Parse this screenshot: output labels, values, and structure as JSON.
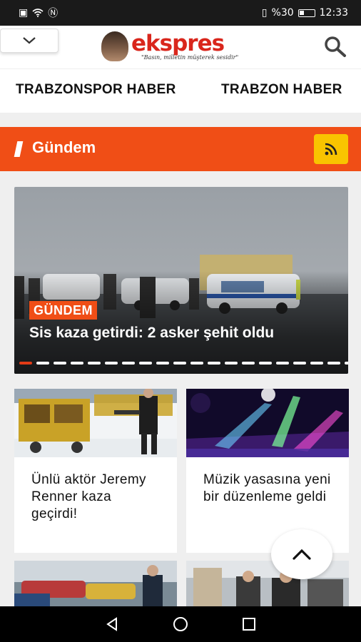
{
  "status_bar": {
    "battery_percent": "%30",
    "time": "12:33"
  },
  "header": {
    "logo_name": "ekspres",
    "logo_tagline": "\"Basın, milletin müşterek sesidir\""
  },
  "nav": {
    "items": [
      "TRABZONSPOR HABER",
      "TRABZON HABER"
    ]
  },
  "section": {
    "title": "Gündem"
  },
  "hero": {
    "badge": "GÜNDEM",
    "title": "Sis kaza getirdi: 2 asker şehit oldu",
    "slide_count": 21,
    "active_slide": 1
  },
  "cards": [
    {
      "title": "Ünlü aktör Jeremy Renner kaza geçirdi!"
    },
    {
      "title": "Müzik yasasına yeni bir düzenleme geldi"
    }
  ],
  "colors": {
    "accent": "#f04e16",
    "rss": "#f9c400",
    "logo_red": "#d9261c"
  }
}
